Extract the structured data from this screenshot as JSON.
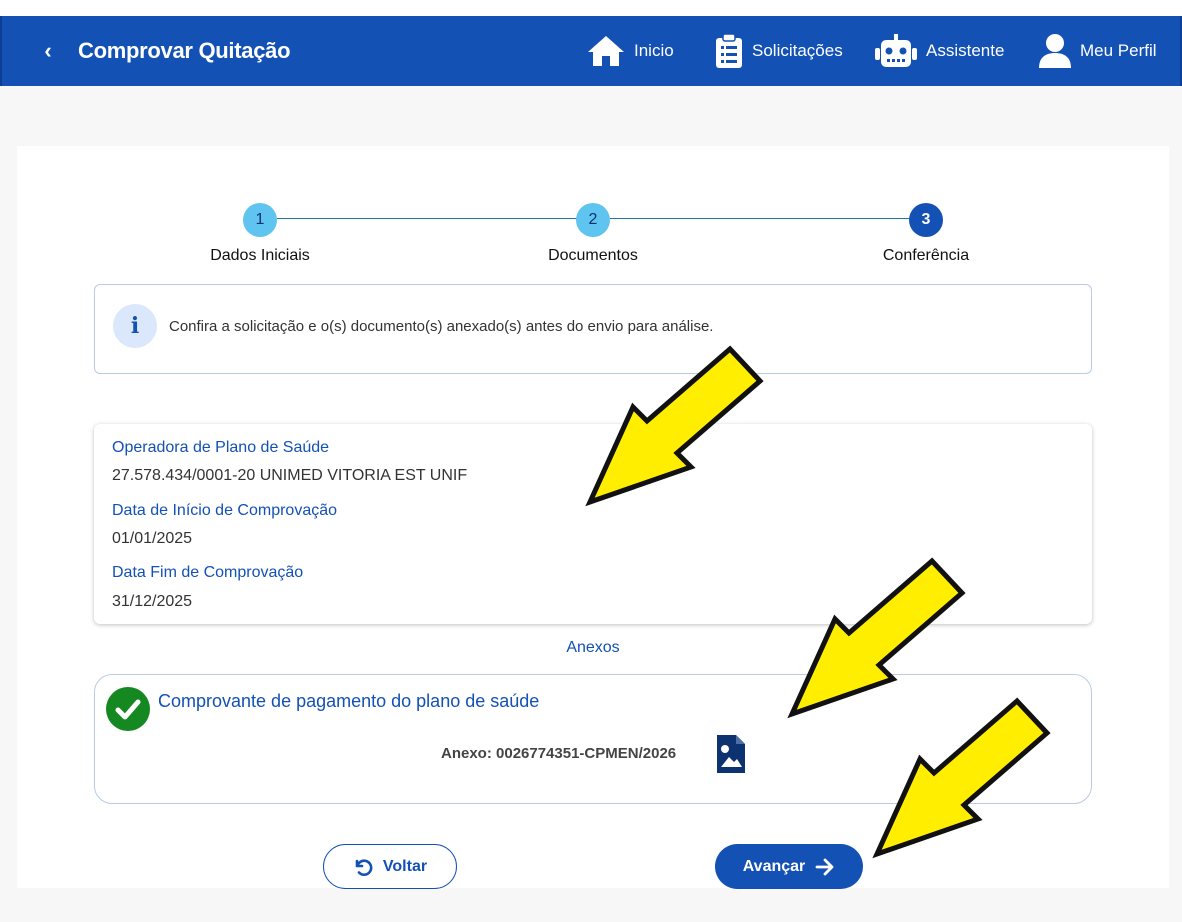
{
  "header": {
    "title": "Comprovar Quitação",
    "nav": [
      {
        "label": "Inicio",
        "icon": "home-icon"
      },
      {
        "label": "Solicitações",
        "icon": "clipboard-list-icon"
      },
      {
        "label": "Assistente",
        "icon": "robot-icon"
      },
      {
        "label": "Meu Perfil",
        "icon": "user-icon"
      }
    ]
  },
  "stepper": {
    "steps": [
      {
        "number": "1",
        "label": "Dados Iniciais",
        "state": "done"
      },
      {
        "number": "2",
        "label": "Documentos",
        "state": "done"
      },
      {
        "number": "3",
        "label": "Conferência",
        "state": "active"
      }
    ]
  },
  "info": {
    "text": "Confira a solicitação e o(s) documento(s) anexado(s) antes do envio para análise."
  },
  "details": {
    "fields": [
      {
        "label": "Operadora de Plano de Saúde",
        "value": "27.578.434/0001-20 UNIMED VITORIA EST UNIF"
      },
      {
        "label": "Data de Início de Comprovação",
        "value": "01/01/2025"
      },
      {
        "label": "Data Fim de Comprovação",
        "value": "31/12/2025"
      }
    ]
  },
  "attachments": {
    "title": "Anexos",
    "item": {
      "name": "Comprovante de pagamento do plano de saúde",
      "file": "Anexo: 0026774351-CPMEN/2026"
    }
  },
  "actions": {
    "back_label": "Voltar",
    "next_label": "Avançar"
  },
  "colors": {
    "primary": "#1351b4",
    "success": "#168821",
    "step_done": "#5fc4ef",
    "annotation_arrow": "#ffee00"
  }
}
